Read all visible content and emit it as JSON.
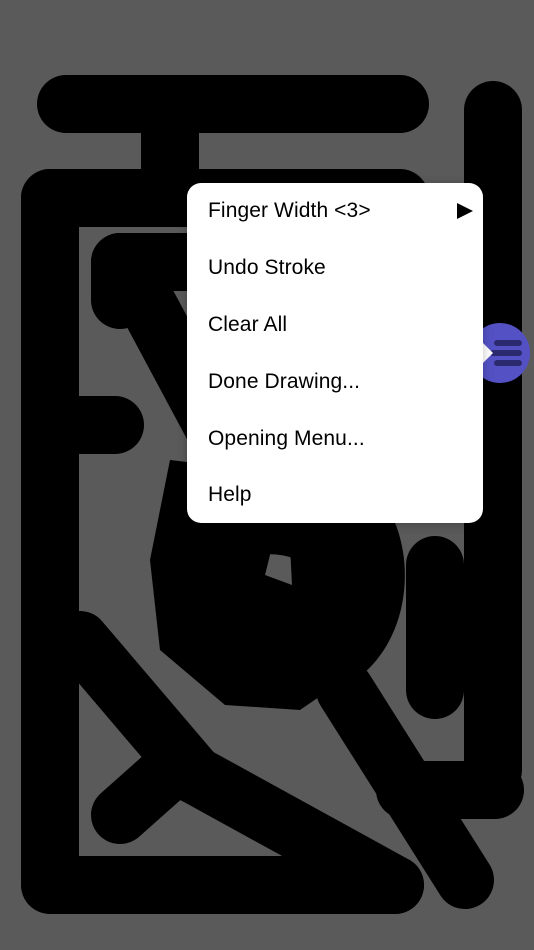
{
  "menu": {
    "items": [
      {
        "label": "Finger Width <3>",
        "has_submenu": true
      },
      {
        "label": "Undo Stroke",
        "has_submenu": false
      },
      {
        "label": "Clear All",
        "has_submenu": false
      },
      {
        "label": "Done Drawing...",
        "has_submenu": false
      },
      {
        "label": "Opening Menu...",
        "has_submenu": false
      },
      {
        "label": "Help",
        "has_submenu": false
      }
    ]
  },
  "icons": {
    "handle": "menu-handle-icon",
    "submenu": "submenu-arrow-icon"
  },
  "colors": {
    "canvas_background": "#5a5a5a",
    "stroke": "#000000",
    "menu_background": "#ffffff",
    "handle": "#5451c5"
  }
}
